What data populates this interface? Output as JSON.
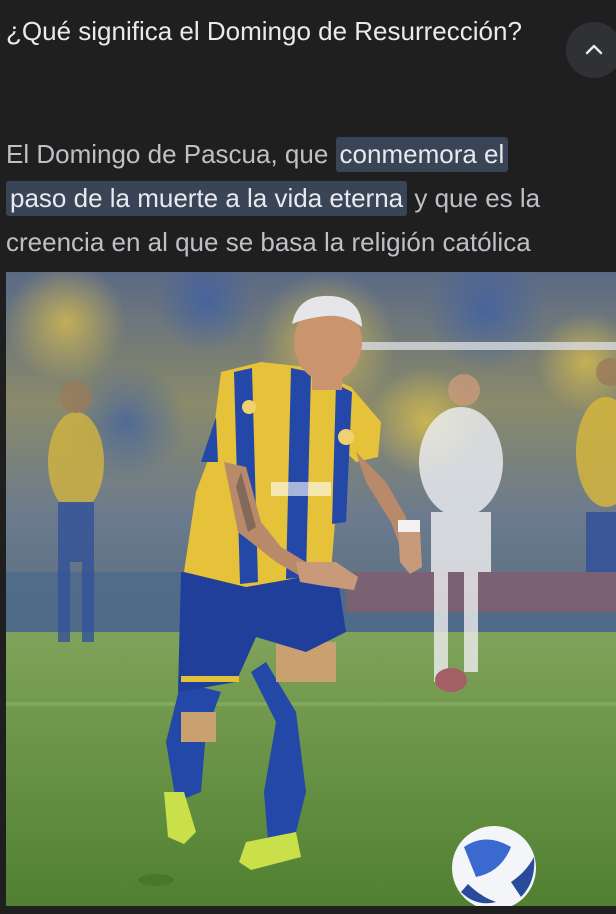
{
  "question": {
    "title": "¿Qué significa el Domingo de Resurrección?"
  },
  "answer": {
    "line1_pre": "El Domingo de Pascua, que ",
    "line1_highlight": "conmemora el",
    "line2_highlight": "paso de la muerte a la vida eterna",
    "line2_post": " y que es la",
    "line3": "creencia en al que se basa la religión católica"
  },
  "icons": {
    "collapse": "chevron-up-icon"
  },
  "colors": {
    "background": "#1f1f1f",
    "highlight": "#394457",
    "text": "#e8eaed",
    "muted_text": "#bdc1c6"
  }
}
